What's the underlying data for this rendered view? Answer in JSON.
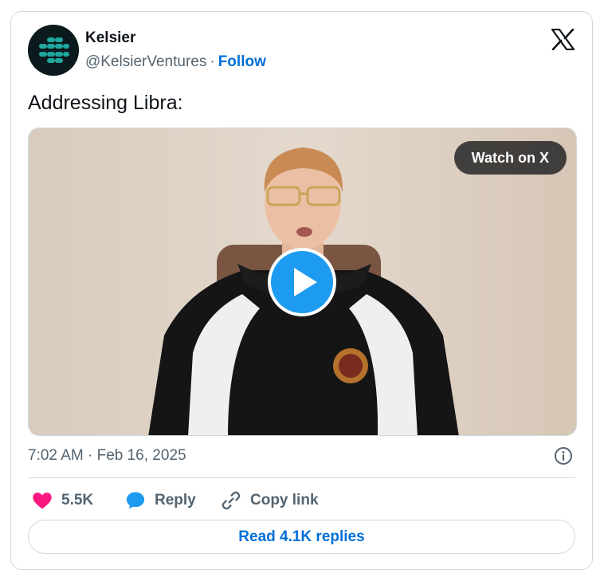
{
  "tweet": {
    "author": {
      "name": "Kelsier",
      "handle": "@KelsierVentures",
      "separator": "·",
      "follow_label": "Follow"
    },
    "text": "Addressing Libra:",
    "media": {
      "type": "video",
      "watch_label": "Watch on X"
    },
    "timestamp": "7:02 AM · Feb 16, 2025",
    "actions": {
      "like_count": "5.5K",
      "reply_label": "Reply",
      "copy_link_label": "Copy link"
    },
    "read_replies_label": "Read 4.1K replies"
  },
  "icons": {
    "platform_logo": "x-logo-icon",
    "play": "play-icon",
    "info": "info-icon",
    "like": "heart-icon",
    "reply": "speech-bubble-icon",
    "copy_link": "link-icon"
  },
  "colors": {
    "link_blue": "#006fd6",
    "play_blue": "#1d9bf0",
    "like_pink": "#f91880",
    "secondary_text": "#536471",
    "border": "#cfd9de"
  }
}
